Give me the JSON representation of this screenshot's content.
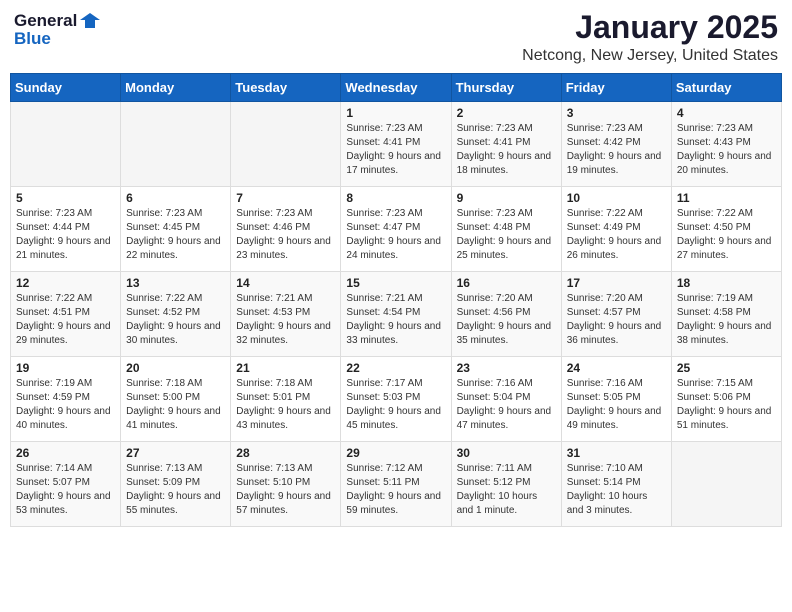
{
  "header": {
    "logo_general": "General",
    "logo_blue": "Blue",
    "title": "January 2025",
    "subtitle": "Netcong, New Jersey, United States"
  },
  "weekdays": [
    "Sunday",
    "Monday",
    "Tuesday",
    "Wednesday",
    "Thursday",
    "Friday",
    "Saturday"
  ],
  "weeks": [
    [
      {
        "day": "",
        "sunrise": "",
        "sunset": "",
        "daylight": "",
        "empty": true
      },
      {
        "day": "",
        "sunrise": "",
        "sunset": "",
        "daylight": "",
        "empty": true
      },
      {
        "day": "",
        "sunrise": "",
        "sunset": "",
        "daylight": "",
        "empty": true
      },
      {
        "day": "1",
        "sunrise": "Sunrise: 7:23 AM",
        "sunset": "Sunset: 4:41 PM",
        "daylight": "Daylight: 9 hours and 17 minutes."
      },
      {
        "day": "2",
        "sunrise": "Sunrise: 7:23 AM",
        "sunset": "Sunset: 4:41 PM",
        "daylight": "Daylight: 9 hours and 18 minutes."
      },
      {
        "day": "3",
        "sunrise": "Sunrise: 7:23 AM",
        "sunset": "Sunset: 4:42 PM",
        "daylight": "Daylight: 9 hours and 19 minutes."
      },
      {
        "day": "4",
        "sunrise": "Sunrise: 7:23 AM",
        "sunset": "Sunset: 4:43 PM",
        "daylight": "Daylight: 9 hours and 20 minutes."
      }
    ],
    [
      {
        "day": "5",
        "sunrise": "Sunrise: 7:23 AM",
        "sunset": "Sunset: 4:44 PM",
        "daylight": "Daylight: 9 hours and 21 minutes."
      },
      {
        "day": "6",
        "sunrise": "Sunrise: 7:23 AM",
        "sunset": "Sunset: 4:45 PM",
        "daylight": "Daylight: 9 hours and 22 minutes."
      },
      {
        "day": "7",
        "sunrise": "Sunrise: 7:23 AM",
        "sunset": "Sunset: 4:46 PM",
        "daylight": "Daylight: 9 hours and 23 minutes."
      },
      {
        "day": "8",
        "sunrise": "Sunrise: 7:23 AM",
        "sunset": "Sunset: 4:47 PM",
        "daylight": "Daylight: 9 hours and 24 minutes."
      },
      {
        "day": "9",
        "sunrise": "Sunrise: 7:23 AM",
        "sunset": "Sunset: 4:48 PM",
        "daylight": "Daylight: 9 hours and 25 minutes."
      },
      {
        "day": "10",
        "sunrise": "Sunrise: 7:22 AM",
        "sunset": "Sunset: 4:49 PM",
        "daylight": "Daylight: 9 hours and 26 minutes."
      },
      {
        "day": "11",
        "sunrise": "Sunrise: 7:22 AM",
        "sunset": "Sunset: 4:50 PM",
        "daylight": "Daylight: 9 hours and 27 minutes."
      }
    ],
    [
      {
        "day": "12",
        "sunrise": "Sunrise: 7:22 AM",
        "sunset": "Sunset: 4:51 PM",
        "daylight": "Daylight: 9 hours and 29 minutes."
      },
      {
        "day": "13",
        "sunrise": "Sunrise: 7:22 AM",
        "sunset": "Sunset: 4:52 PM",
        "daylight": "Daylight: 9 hours and 30 minutes."
      },
      {
        "day": "14",
        "sunrise": "Sunrise: 7:21 AM",
        "sunset": "Sunset: 4:53 PM",
        "daylight": "Daylight: 9 hours and 32 minutes."
      },
      {
        "day": "15",
        "sunrise": "Sunrise: 7:21 AM",
        "sunset": "Sunset: 4:54 PM",
        "daylight": "Daylight: 9 hours and 33 minutes."
      },
      {
        "day": "16",
        "sunrise": "Sunrise: 7:20 AM",
        "sunset": "Sunset: 4:56 PM",
        "daylight": "Daylight: 9 hours and 35 minutes."
      },
      {
        "day": "17",
        "sunrise": "Sunrise: 7:20 AM",
        "sunset": "Sunset: 4:57 PM",
        "daylight": "Daylight: 9 hours and 36 minutes."
      },
      {
        "day": "18",
        "sunrise": "Sunrise: 7:19 AM",
        "sunset": "Sunset: 4:58 PM",
        "daylight": "Daylight: 9 hours and 38 minutes."
      }
    ],
    [
      {
        "day": "19",
        "sunrise": "Sunrise: 7:19 AM",
        "sunset": "Sunset: 4:59 PM",
        "daylight": "Daylight: 9 hours and 40 minutes."
      },
      {
        "day": "20",
        "sunrise": "Sunrise: 7:18 AM",
        "sunset": "Sunset: 5:00 PM",
        "daylight": "Daylight: 9 hours and 41 minutes."
      },
      {
        "day": "21",
        "sunrise": "Sunrise: 7:18 AM",
        "sunset": "Sunset: 5:01 PM",
        "daylight": "Daylight: 9 hours and 43 minutes."
      },
      {
        "day": "22",
        "sunrise": "Sunrise: 7:17 AM",
        "sunset": "Sunset: 5:03 PM",
        "daylight": "Daylight: 9 hours and 45 minutes."
      },
      {
        "day": "23",
        "sunrise": "Sunrise: 7:16 AM",
        "sunset": "Sunset: 5:04 PM",
        "daylight": "Daylight: 9 hours and 47 minutes."
      },
      {
        "day": "24",
        "sunrise": "Sunrise: 7:16 AM",
        "sunset": "Sunset: 5:05 PM",
        "daylight": "Daylight: 9 hours and 49 minutes."
      },
      {
        "day": "25",
        "sunrise": "Sunrise: 7:15 AM",
        "sunset": "Sunset: 5:06 PM",
        "daylight": "Daylight: 9 hours and 51 minutes."
      }
    ],
    [
      {
        "day": "26",
        "sunrise": "Sunrise: 7:14 AM",
        "sunset": "Sunset: 5:07 PM",
        "daylight": "Daylight: 9 hours and 53 minutes."
      },
      {
        "day": "27",
        "sunrise": "Sunrise: 7:13 AM",
        "sunset": "Sunset: 5:09 PM",
        "daylight": "Daylight: 9 hours and 55 minutes."
      },
      {
        "day": "28",
        "sunrise": "Sunrise: 7:13 AM",
        "sunset": "Sunset: 5:10 PM",
        "daylight": "Daylight: 9 hours and 57 minutes."
      },
      {
        "day": "29",
        "sunrise": "Sunrise: 7:12 AM",
        "sunset": "Sunset: 5:11 PM",
        "daylight": "Daylight: 9 hours and 59 minutes."
      },
      {
        "day": "30",
        "sunrise": "Sunrise: 7:11 AM",
        "sunset": "Sunset: 5:12 PM",
        "daylight": "Daylight: 10 hours and 1 minute."
      },
      {
        "day": "31",
        "sunrise": "Sunrise: 7:10 AM",
        "sunset": "Sunset: 5:14 PM",
        "daylight": "Daylight: 10 hours and 3 minutes."
      },
      {
        "day": "",
        "sunrise": "",
        "sunset": "",
        "daylight": "",
        "empty": true
      }
    ]
  ]
}
